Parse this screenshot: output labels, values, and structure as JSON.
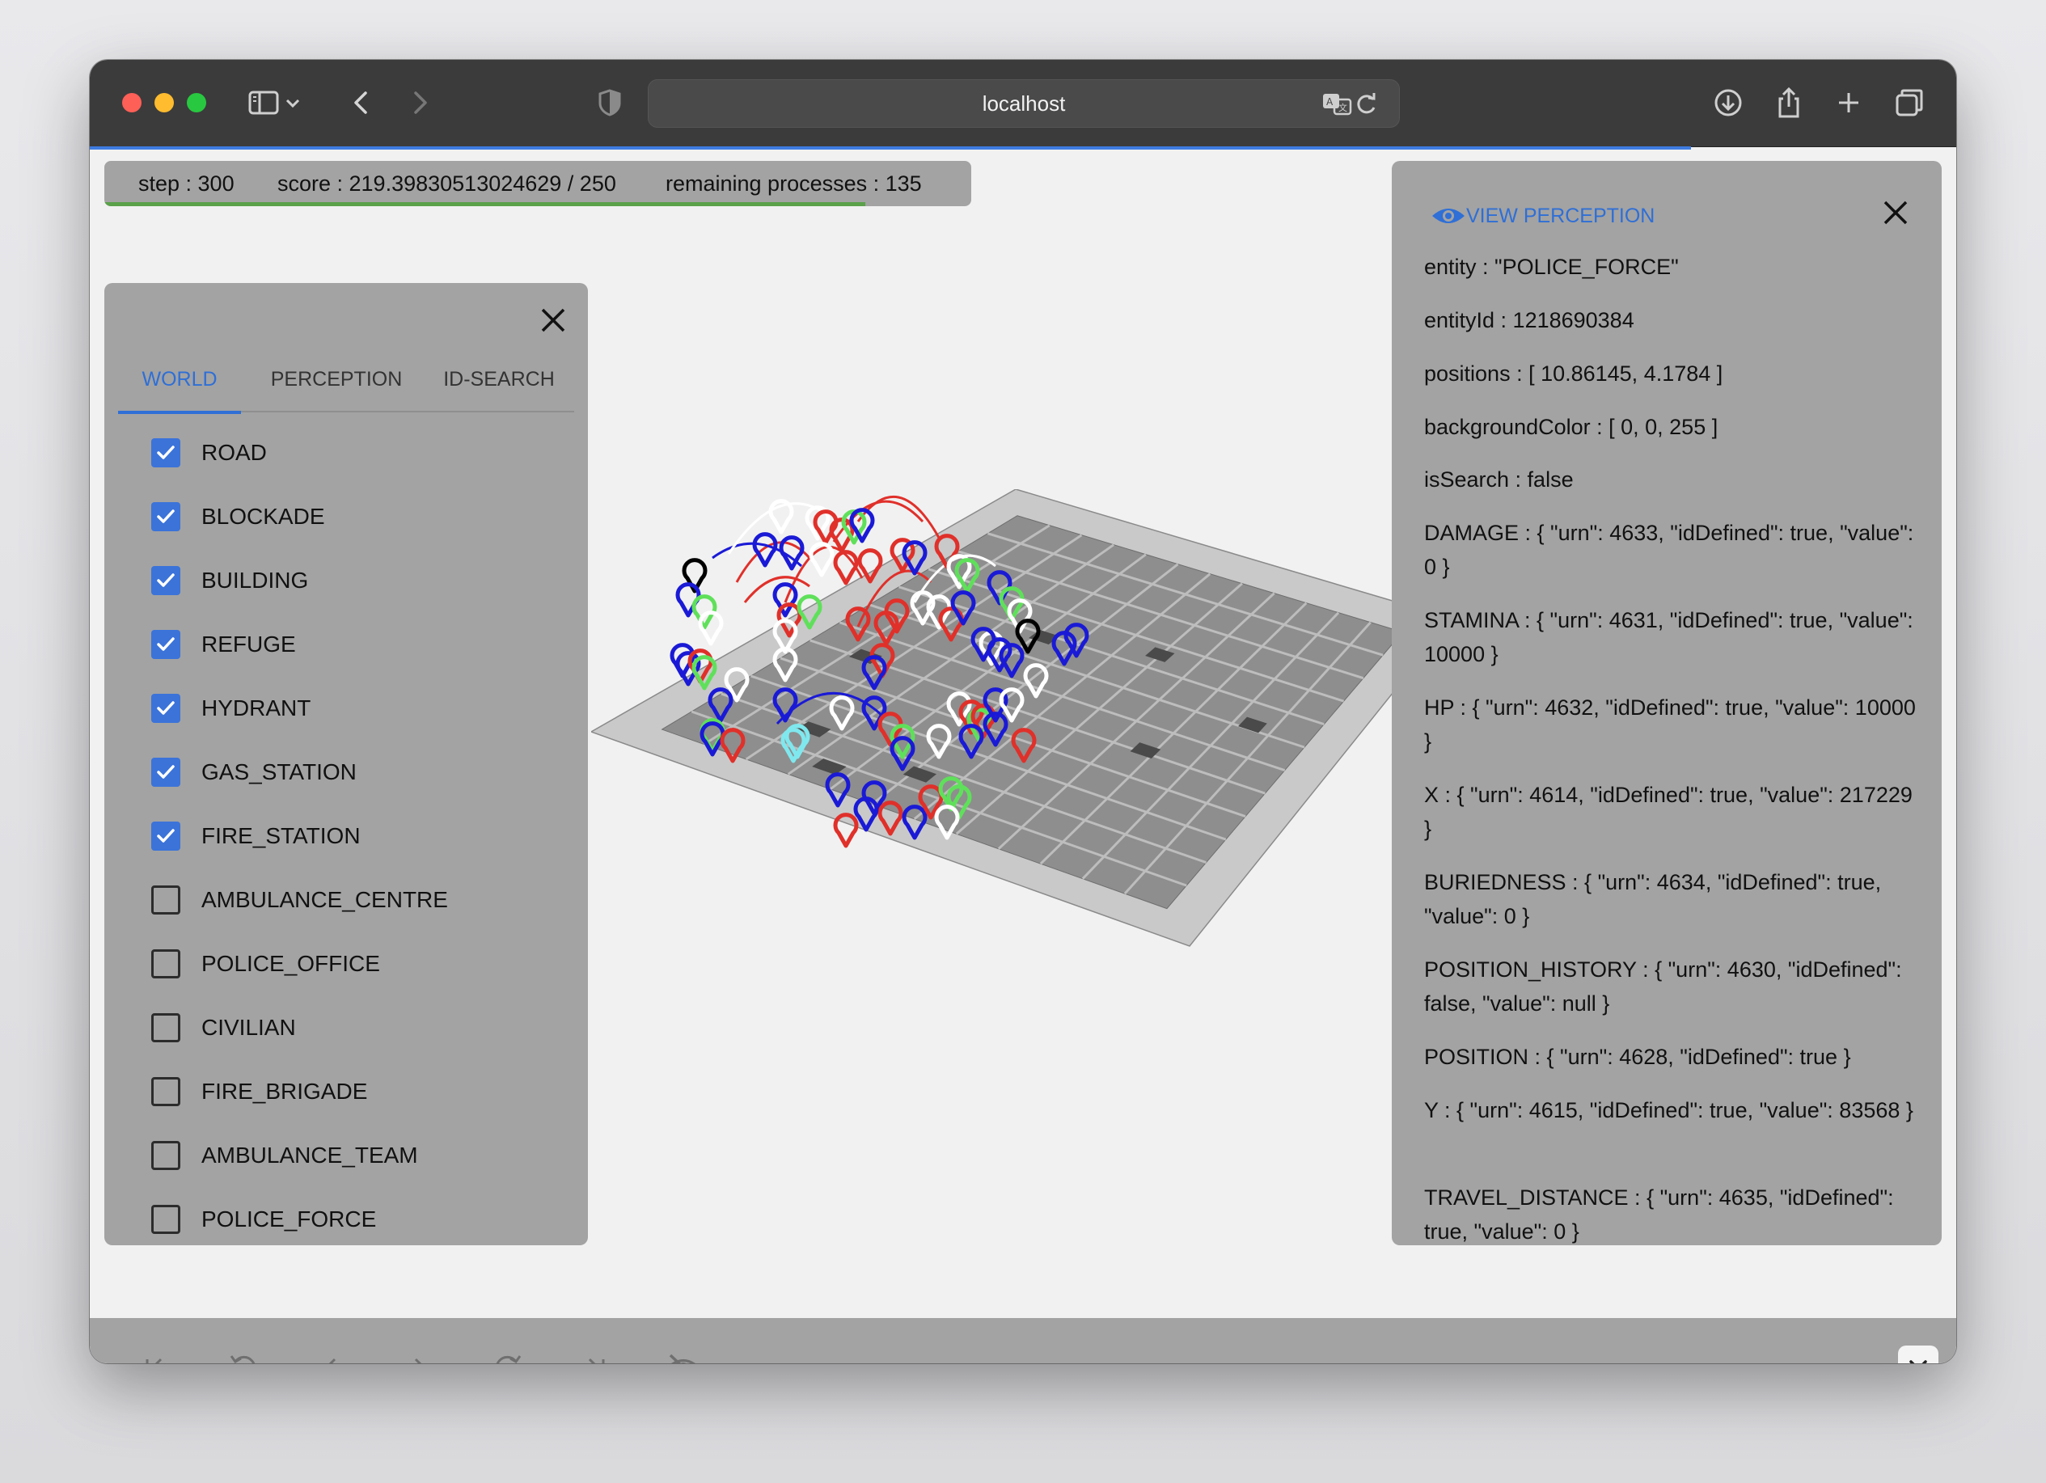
{
  "browser": {
    "url": "localhost",
    "icons": [
      "sidebar-icon",
      "chevron-down-icon",
      "back-icon",
      "forward-icon",
      "shield-icon",
      "translate-icon",
      "reload-icon",
      "download-icon",
      "share-icon",
      "new-tab-icon",
      "tabs-overview-icon"
    ]
  },
  "status": {
    "step": "step : 300",
    "score": "score : 219.39830513024629 / 250",
    "remaining": "remaining processes : 135",
    "progress": 0.878
  },
  "layers_panel": {
    "tabs": [
      "WORLD",
      "PERCEPTION",
      "ID-SEARCH"
    ],
    "active_tab": "WORLD",
    "layers": [
      {
        "label": "ROAD",
        "checked": true
      },
      {
        "label": "BLOCKADE",
        "checked": true
      },
      {
        "label": "BUILDING",
        "checked": true
      },
      {
        "label": "REFUGE",
        "checked": true
      },
      {
        "label": "HYDRANT",
        "checked": true
      },
      {
        "label": "GAS_STATION",
        "checked": true
      },
      {
        "label": "FIRE_STATION",
        "checked": true
      },
      {
        "label": "AMBULANCE_CENTRE",
        "checked": false
      },
      {
        "label": "POLICE_OFFICE",
        "checked": false
      },
      {
        "label": "CIVILIAN",
        "checked": false
      },
      {
        "label": "FIRE_BRIGADE",
        "checked": false
      },
      {
        "label": "AMBULANCE_TEAM",
        "checked": false
      },
      {
        "label": "POLICE_FORCE",
        "checked": false
      }
    ]
  },
  "perception_panel": {
    "title": "VIEW PERCEPTION",
    "properties": [
      "entity : \"POLICE_FORCE\"",
      "entityId : 1218690384",
      "positions : [ 10.86145, 4.1784 ]",
      "backgroundColor : [ 0, 0, 255 ]",
      "isSearch : false",
      "DAMAGE : { \"urn\": 4633, \"idDefined\": true, \"value\": 0 }",
      "STAMINA : { \"urn\": 4631, \"idDefined\": true, \"value\": 10000 }",
      "HP : { \"urn\": 4632, \"idDefined\": true, \"value\": 10000 }",
      "X : { \"urn\": 4614, \"idDefined\": true, \"value\": 217229 }",
      "BURIEDNESS : { \"urn\": 4634, \"idDefined\": true, \"value\": 0 }",
      "POSITION_HISTORY : { \"urn\": 4630, \"idDefined\": false, \"value\": null }",
      "POSITION : { \"urn\": 4628, \"idDefined\": true }",
      "Y : { \"urn\": 4615, \"idDefined\": true, \"value\": 83568 }",
      "TRAVEL_DISTANCE : { \"urn\": 4635, \"idDefined\": true, \"value\": 0 }"
    ]
  },
  "playback": {
    "controls": [
      "skip-start-icon",
      "rewind-10-icon",
      "step-back-icon",
      "step-forward-icon",
      "forward-10-icon",
      "skip-end-icon",
      "hide-icon"
    ]
  },
  "colors": {
    "accent": "#2f6fd6",
    "panel": "#a3a3a3",
    "marker_red": "#e0302a",
    "marker_blue": "#1a1ad6",
    "marker_green": "#5fe05a",
    "marker_white": "#ffffff",
    "marker_black": "#000000",
    "marker_cyan": "#7fe8ee"
  }
}
